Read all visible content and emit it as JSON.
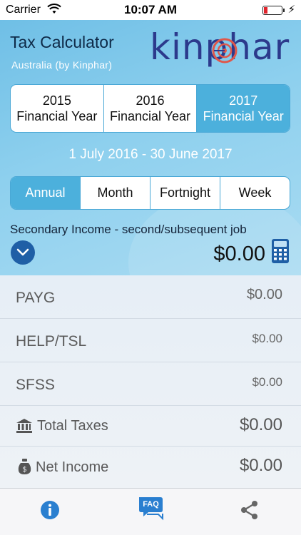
{
  "status_bar": {
    "carrier": "Carrier",
    "time": "10:07 AM"
  },
  "app": {
    "title": "Tax Calculator",
    "subtitle": "Australia (by Kinphar)",
    "logo_text": "kinphar"
  },
  "years": [
    {
      "line1": "2015",
      "line2": "Financial Year",
      "active": false
    },
    {
      "line1": "2016",
      "line2": "Financial Year",
      "active": false
    },
    {
      "line1": "2017",
      "line2": "Financial Year",
      "active": true
    }
  ],
  "date_range": "1 July 2016 - 30 June 2017",
  "periods": [
    {
      "label": "Annual",
      "active": true
    },
    {
      "label": "Month",
      "active": false
    },
    {
      "label": "Fortnight",
      "active": false
    },
    {
      "label": "Week",
      "active": false
    }
  ],
  "income": {
    "label": "Secondary Income - second/subsequent job",
    "amount": "$0.00"
  },
  "results": {
    "payg": {
      "label": "PAYG",
      "value": "$0.00"
    },
    "help": {
      "label": "HELP/TSL",
      "value": "$0.00"
    },
    "sfss": {
      "label": "SFSS",
      "value": "$0.00"
    },
    "total": {
      "label": "Total Taxes",
      "value": "$0.00"
    },
    "net": {
      "label": "Net Income",
      "value": "$0.00"
    }
  },
  "tab_bar": {
    "faq_label": "FAQ"
  },
  "colors": {
    "accent": "#4cb0dc",
    "dark_blue": "#1f5fa6",
    "logo_blue": "#2c3a8c",
    "logo_accent": "#e0574a"
  }
}
